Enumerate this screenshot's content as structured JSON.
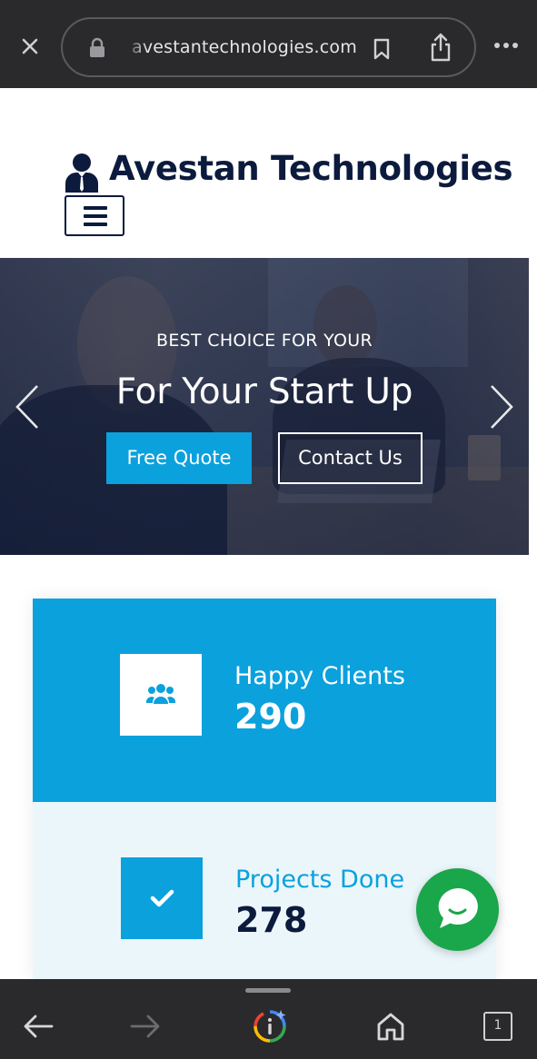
{
  "browser": {
    "url": "avestantechnologies.com",
    "icons": {
      "close": "close-icon",
      "lock": "lock-icon",
      "bookmark": "bookmark-icon",
      "share": "share-icon",
      "more": "more-icon"
    }
  },
  "site": {
    "brand": "Avestan Technologies",
    "logo_icon": "businessman-icon",
    "menu_icon": "hamburger-menu-icon"
  },
  "hero": {
    "kicker": "BEST CHOICE FOR YOUR",
    "title": "For Your Start Up",
    "primary_button": "Free Quote",
    "secondary_button": "Contact Us",
    "prev_icon": "chevron-left-icon",
    "next_icon": "chevron-right-icon"
  },
  "stats": [
    {
      "label": "Happy Clients",
      "value": "290",
      "icon": "users-icon"
    },
    {
      "label": "Projects Done",
      "value": "278",
      "icon": "check-icon"
    }
  ],
  "chat": {
    "icon": "chat-bubble-icon"
  },
  "bottom_nav": {
    "tab_count": "1",
    "icons": [
      "back-arrow-icon",
      "forward-arrow-icon",
      "google-assistant-icon",
      "home-icon",
      "tabs-icon"
    ]
  },
  "colors": {
    "accent": "#0aa1dd",
    "brand_dark": "#0b1a3d",
    "chat_green": "#1aa64a",
    "browser_chrome": "#2a2a2c",
    "stat_light_bg": "#ebf6fb"
  }
}
